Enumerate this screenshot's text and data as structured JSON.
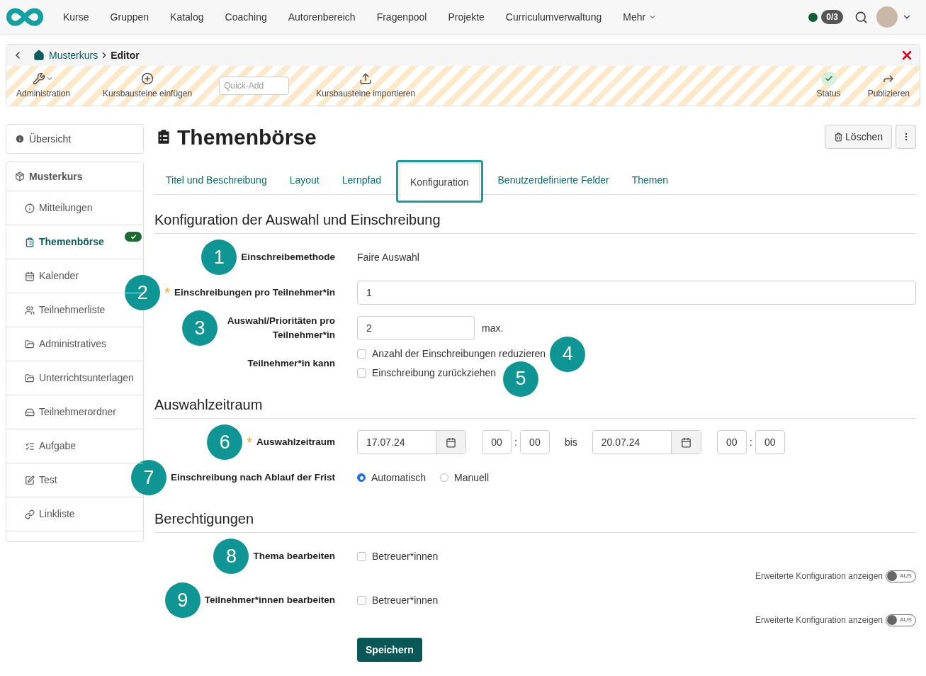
{
  "nav": {
    "items": [
      "Kurse",
      "Gruppen",
      "Katalog",
      "Coaching",
      "Autorenbereich",
      "Fragenpool",
      "Projekte",
      "Curriculumverwaltung"
    ],
    "more": "Mehr",
    "online": true,
    "badge": "0/3"
  },
  "breadcrumb": {
    "items": [
      "Musterkurs",
      "Editor"
    ]
  },
  "toolbar": [
    {
      "kind": "button",
      "label": "Administration",
      "caret": true
    },
    {
      "kind": "button",
      "label": "Kursbausteine einfügen",
      "caret": false
    },
    {
      "kind": "field",
      "placeholder": "Quick-Add"
    },
    {
      "kind": "button",
      "label": "Kursbausteine importieren",
      "caret": false
    },
    {
      "kind": "spacer"
    },
    {
      "kind": "status",
      "label": "Status"
    },
    {
      "kind": "button",
      "label": "Publizieren",
      "caret": false
    }
  ],
  "sidebar": {
    "overview": "Übersicht",
    "course": "Musterkurs",
    "items": [
      {
        "label": "Mitteilungen",
        "selected": false,
        "done": false
      },
      {
        "label": "Themenbörse",
        "selected": true,
        "done": true
      },
      {
        "label": "Kalender",
        "selected": false,
        "done": false
      },
      {
        "label": "Teilnehmerliste",
        "selected": false,
        "done": false
      },
      {
        "label": "Administratives",
        "selected": false,
        "done": false
      },
      {
        "label": "Unterrichtsunterlagen",
        "selected": false,
        "done": false
      },
      {
        "label": "Teilnehmerordner",
        "selected": false,
        "done": false
      },
      {
        "label": "Aufgabe",
        "selected": false,
        "done": false
      },
      {
        "label": "Test",
        "selected": false,
        "done": false
      },
      {
        "label": "Linkliste",
        "selected": false,
        "done": false
      }
    ]
  },
  "title": "Themenbörse",
  "delete": "Löschen",
  "tabs": [
    {
      "label": "Titel und Beschreibung",
      "selected": false
    },
    {
      "label": "Layout",
      "selected": false
    },
    {
      "label": "Lernpfad",
      "selected": false
    },
    {
      "label": "Konfiguration",
      "selected": true
    },
    {
      "label": "Benutzerdefinierte Felder",
      "selected": false
    },
    {
      "label": "Themen",
      "selected": false
    }
  ],
  "sections": [
    {
      "title": "Konfiguration der Auswahl und Einschreibung",
      "rows": [
        {
          "kind": "text",
          "callout": "1",
          "label": "Einschreibemethode",
          "value": "Faire Auswahl"
        },
        {
          "kind": "input",
          "callout": "2",
          "label": "Einschreibungen pro Teilnehmer*in",
          "required_mark": "*",
          "value": "1",
          "wide": true
        },
        {
          "kind": "input",
          "callout": "3",
          "label": "Auswahl/Prioritäten pro Teilnehmer*in",
          "wrap": true,
          "value": "2",
          "wide": false,
          "suffix": "max."
        },
        {
          "kind": "checkboxes",
          "label": "Teilnehmer*in kann",
          "options": [
            {
              "label": "Anzahl der Einschreibungen reduzieren",
              "checked": false,
              "callout": "4"
            },
            {
              "label": "Einschreibung zurückziehen",
              "checked": false,
              "callout": "5"
            }
          ]
        }
      ]
    },
    {
      "title": "Auswahlzeitraum",
      "rows": [
        {
          "kind": "daterange",
          "callout": "6",
          "label": "Auswahlzeitraum",
          "required_mark": "*",
          "from": {
            "date": "17.07.24",
            "hour": "00",
            "time_separator": ":",
            "minute": "00"
          },
          "separator": "bis",
          "to": {
            "date": "20.07.24",
            "hour": "00",
            "time_separator": ":",
            "minute": "00"
          }
        },
        {
          "kind": "radio",
          "callout": "7",
          "label": "Einschreibung nach Ablauf der Frist",
          "options": [
            {
              "label": "Automatisch",
              "selected": true
            },
            {
              "label": "Manuell",
              "selected": false
            }
          ]
        }
      ]
    },
    {
      "title": "Berechtigungen",
      "rows": [
        {
          "kind": "checkboxes",
          "callout": "8",
          "label": "Thema bearbeiten",
          "options": [
            {
              "label": "Betreuer*innen",
              "checked": false
            }
          ],
          "toggle": {
            "label": "Erweiterte Konfiguration anzeigen",
            "on": false,
            "text": "AUS"
          }
        },
        {
          "kind": "checkboxes",
          "callout": "9",
          "label": "Teilnehmer*innen bearbeiten",
          "options": [
            {
              "label": "Betreuer*innen",
              "checked": false
            }
          ],
          "toggle": {
            "label": "Erweiterte Konfiguration anzeigen",
            "on": false,
            "text": "AUS"
          }
        }
      ]
    }
  ],
  "save": "Speichern"
}
